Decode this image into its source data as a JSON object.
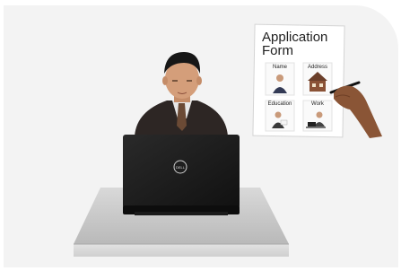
{
  "form": {
    "title_line1": "Application",
    "title_line2": "Form",
    "cells": {
      "name": "Name",
      "address": "Address",
      "education": "Education",
      "work": "Work"
    }
  },
  "laptop": {
    "brand": "DELL"
  }
}
